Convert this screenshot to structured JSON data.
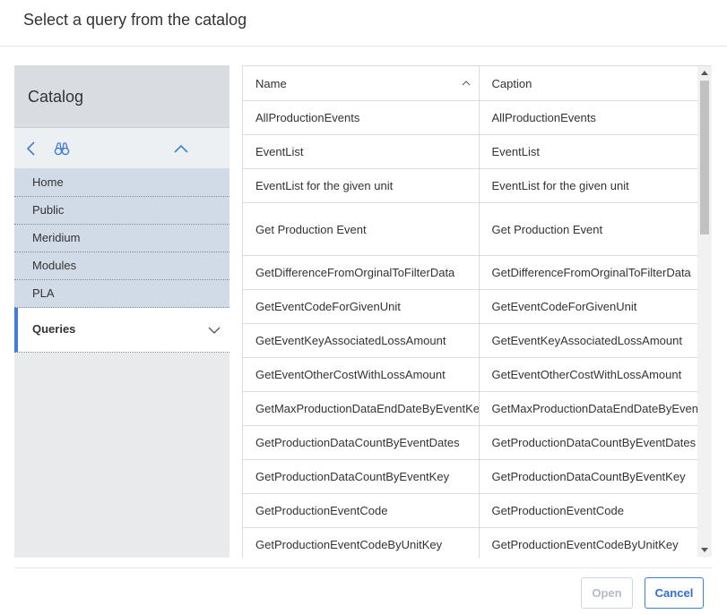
{
  "dialog": {
    "title": "Select a query from the catalog"
  },
  "catalog": {
    "title": "Catalog",
    "toolbar": {
      "back_icon": "chevron-left-icon",
      "search_icon": "binoculars-icon",
      "collapse_icon": "chevron-up-icon"
    },
    "items": [
      {
        "label": "Home"
      },
      {
        "label": "Public"
      },
      {
        "label": "Meridium"
      },
      {
        "label": "Modules"
      },
      {
        "label": "PLA"
      }
    ],
    "selected": {
      "label": "Queries",
      "icon": "chevron-down-icon"
    }
  },
  "grid": {
    "columns": [
      {
        "label": "Name",
        "sort": "ascending"
      },
      {
        "label": "Caption"
      }
    ],
    "rows": [
      {
        "name": "AllProductionEvents",
        "caption": "AllProductionEvents"
      },
      {
        "name": "EventList",
        "caption": "EventList"
      },
      {
        "name": "EventList for the given unit",
        "caption": "EventList for the given unit"
      },
      {
        "name": "Get Production Event",
        "caption": "Get Production Event"
      },
      {
        "name": "GetDifferenceFromOrginalToFilterData",
        "caption": "GetDifferenceFromOrginalToFilterData"
      },
      {
        "name": "GetEventCodeForGivenUnit",
        "caption": "GetEventCodeForGivenUnit"
      },
      {
        "name": "GetEventKeyAssociatedLossAmount",
        "caption": "GetEventKeyAssociatedLossAmount"
      },
      {
        "name": "GetEventOtherCostWithLossAmount",
        "caption": "GetEventOtherCostWithLossAmount"
      },
      {
        "name": "GetMaxProductionDataEndDateByEventKey",
        "caption": "GetMaxProductionDataEndDateByEventKey"
      },
      {
        "name": "GetProductionDataCountByEventDates",
        "caption": "GetProductionDataCountByEventDates"
      },
      {
        "name": "GetProductionDataCountByEventKey",
        "caption": "GetProductionDataCountByEventKey"
      },
      {
        "name": "GetProductionEventCode",
        "caption": "GetProductionEventCode"
      },
      {
        "name": "GetProductionEventCodeByUnitKey",
        "caption": "GetProductionEventCodeByUnitKey"
      }
    ]
  },
  "buttons": {
    "open": "Open",
    "cancel": "Cancel"
  },
  "colors": {
    "accent": "#3f7dd6",
    "tree_bg": "#d1dbe7",
    "panel_bg": "#e9eaec"
  }
}
